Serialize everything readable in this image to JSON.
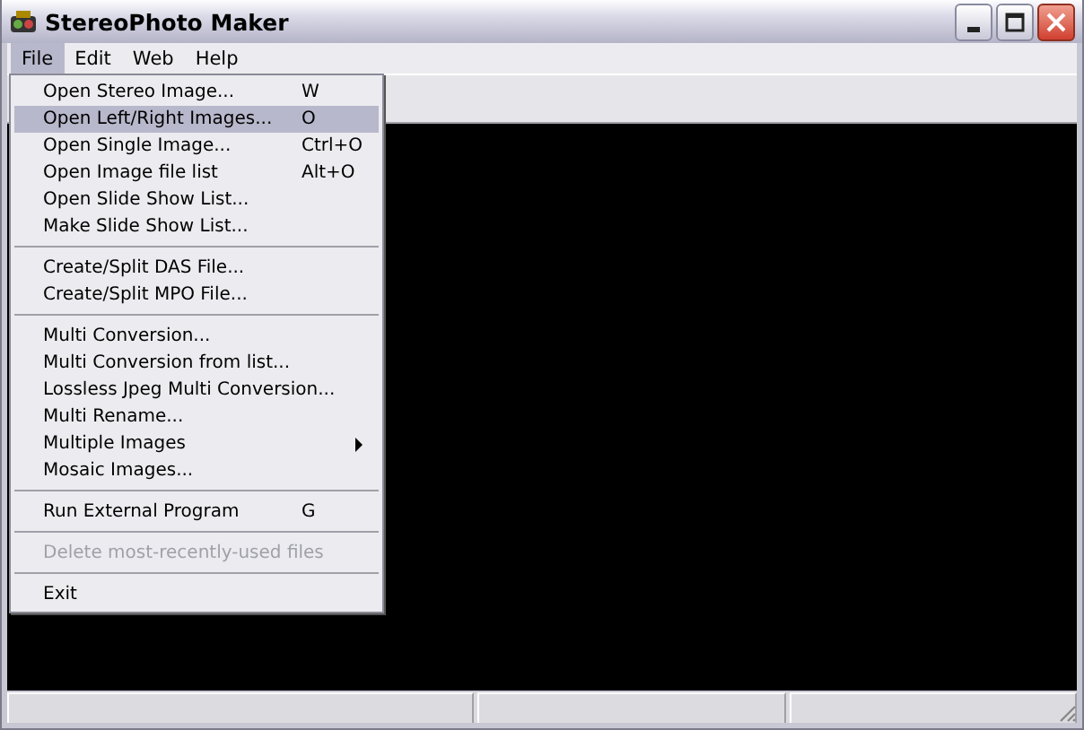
{
  "window": {
    "title": "StereoPhoto Maker"
  },
  "menubar": [
    {
      "label": "File",
      "selected": true
    },
    {
      "label": "Edit",
      "selected": false
    },
    {
      "label": "Web",
      "selected": false
    },
    {
      "label": "Help",
      "selected": false
    }
  ],
  "file_menu": [
    {
      "kind": "item",
      "label": "Open Stereo Image...",
      "shortcut": "W",
      "selected": false,
      "disabled": false,
      "submenu": false
    },
    {
      "kind": "item",
      "label": "Open Left/Right Images...",
      "shortcut": "O",
      "selected": true,
      "disabled": false,
      "submenu": false
    },
    {
      "kind": "item",
      "label": "Open Single Image...",
      "shortcut": "Ctrl+O",
      "selected": false,
      "disabled": false,
      "submenu": false
    },
    {
      "kind": "item",
      "label": "Open Image file list",
      "shortcut": "Alt+O",
      "selected": false,
      "disabled": false,
      "submenu": false
    },
    {
      "kind": "item",
      "label": "Open Slide Show List...",
      "selected": false,
      "disabled": false,
      "submenu": false
    },
    {
      "kind": "item",
      "label": "Make Slide Show List...",
      "selected": false,
      "disabled": false,
      "submenu": false
    },
    {
      "kind": "separator"
    },
    {
      "kind": "item",
      "label": "Create/Split DAS File...",
      "selected": false,
      "disabled": false,
      "submenu": false
    },
    {
      "kind": "item",
      "label": "Create/Split MPO File...",
      "selected": false,
      "disabled": false,
      "submenu": false
    },
    {
      "kind": "separator"
    },
    {
      "kind": "item",
      "label": "Multi Conversion...",
      "selected": false,
      "disabled": false,
      "submenu": false
    },
    {
      "kind": "item",
      "label": "Multi Conversion from list...",
      "selected": false,
      "disabled": false,
      "submenu": false
    },
    {
      "kind": "item",
      "label": "Lossless Jpeg Multi Conversion...",
      "selected": false,
      "disabled": false,
      "submenu": false
    },
    {
      "kind": "item",
      "label": "Multi Rename...",
      "selected": false,
      "disabled": false,
      "submenu": false
    },
    {
      "kind": "item",
      "label": "Multiple Images",
      "selected": false,
      "disabled": false,
      "submenu": true
    },
    {
      "kind": "item",
      "label": "Mosaic Images...",
      "selected": false,
      "disabled": false,
      "submenu": false
    },
    {
      "kind": "separator"
    },
    {
      "kind": "item",
      "label": "Run External Program",
      "shortcut": "G",
      "selected": false,
      "disabled": false,
      "submenu": false
    },
    {
      "kind": "separator"
    },
    {
      "kind": "item",
      "label": "Delete most-recently-used files",
      "selected": false,
      "disabled": true,
      "submenu": false
    },
    {
      "kind": "separator"
    },
    {
      "kind": "item",
      "label": "Exit",
      "selected": false,
      "disabled": false,
      "submenu": false
    }
  ]
}
